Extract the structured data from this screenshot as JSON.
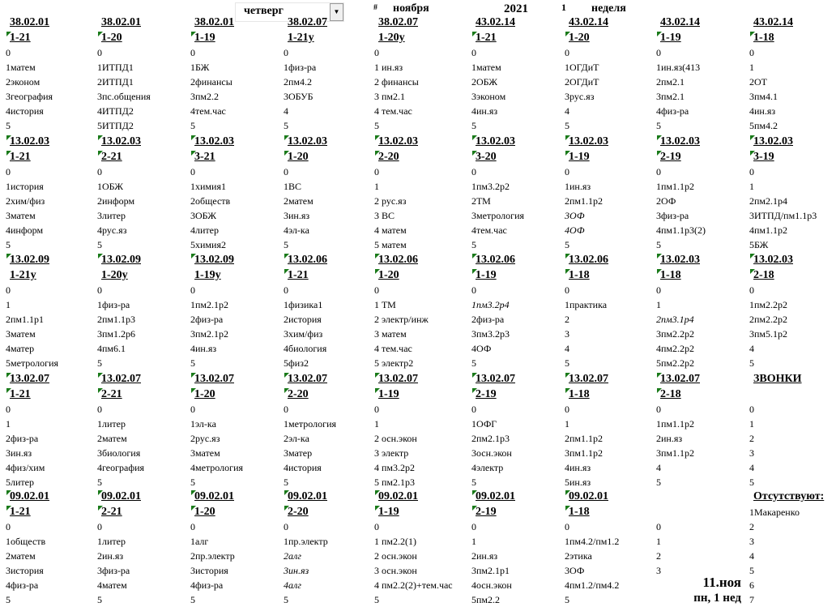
{
  "header": {
    "day_select": "четверг",
    "hash": "#",
    "month": "ноября",
    "year": "2021",
    "week_num": "1",
    "week_label": "неделя"
  },
  "footer": {
    "date": "11.ноя",
    "week_info": "пн, 1 нед"
  },
  "colors": {
    "comment_marker": "#1a7a1a"
  },
  "blocks": [
    [
      {
        "code": "38.02.01",
        "group": "1-21",
        "gm": true,
        "lessons": [
          "0",
          "1матем",
          "2эконом",
          "3география",
          "4история",
          "5"
        ]
      },
      {
        "code": "38.02.01",
        "group": "1-20",
        "gm": true,
        "lessons": [
          "0",
          "1ИТПД1",
          "2ИТПД1",
          "3пс.общения",
          "4ИТПД2",
          "5ИТПД2"
        ]
      },
      {
        "code": "38.02.01",
        "group": "1-19",
        "gm": true,
        "lessons": [
          "0",
          "1БЖ",
          "2финансы",
          "3пм2.2",
          "4тем.час",
          "5"
        ]
      },
      {
        "code": "38.02.07",
        "group": "1-21у",
        "lessons": [
          "0",
          "1физ-ра",
          "2пм4.2",
          "3ОБУБ",
          "4",
          "5"
        ]
      },
      {
        "code": "38.02.07",
        "group": "1-20у",
        "lessons": [
          "0",
          "1 ин.яз",
          "2 финансы",
          "3 пм2.1",
          "4 тем.час",
          "5"
        ]
      },
      {
        "code": "43.02.14",
        "group": "1-21",
        "gm": true,
        "lessons": [
          "0",
          "1матем",
          "2ОБЖ",
          "3эконом",
          "4ин.яз",
          "5"
        ]
      },
      {
        "code": "43.02.14",
        "group": "1-20",
        "gm": true,
        "lessons": [
          "0",
          "1ОГДиТ",
          "2ОГДиТ",
          "3рус.яз",
          "4",
          "5"
        ]
      },
      {
        "code": "43.02.14",
        "group": "1-19",
        "gm": true,
        "lessons": [
          "0",
          "1ин.яз(413",
          "2пм2.1",
          "3пм2.1",
          "4физ-ра",
          "5"
        ]
      },
      {
        "code": "43.02.14",
        "group": "1-18",
        "gm": true,
        "lessons": [
          "0",
          "1",
          "2ОТ",
          "3пм4.1",
          "4ин.яз",
          "5пм4.2"
        ]
      }
    ],
    [
      {
        "code": "13.02.03",
        "group": "1-21",
        "cm": true,
        "gm": true,
        "lessons": [
          "0",
          "1история",
          "2хим/физ",
          "3матем",
          "4информ",
          "5"
        ]
      },
      {
        "code": "13.02.03",
        "group": "2-21",
        "cm": true,
        "gm": true,
        "lessons": [
          "0",
          "1ОБЖ",
          "2информ",
          "3литер",
          "4рус.яз",
          "5"
        ]
      },
      {
        "code": "13.02.03",
        "group": "3-21",
        "cm": true,
        "gm": true,
        "lessons": [
          "0",
          "1химия1",
          "2обществ",
          "3ОБЖ",
          "4литер",
          "5химия2"
        ]
      },
      {
        "code": "13.02.03",
        "group": "1-20",
        "cm": true,
        "gm": true,
        "lessons": [
          "0",
          "1ВС",
          "2матем",
          "3ин.яз",
          "4эл-ка",
          "5"
        ]
      },
      {
        "code": "13.02.03",
        "group": "2-20",
        "cm": true,
        "gm": true,
        "lessons": [
          "0",
          "1",
          "2 рус.яз",
          "3 ВС",
          "4 матем",
          "5 матем"
        ]
      },
      {
        "code": "13.02.03",
        "group": "3-20",
        "cm": true,
        "gm": true,
        "lessons": [
          "0",
          "1пм3.2р2",
          "2ТМ",
          "3метрология",
          "4тем.час",
          "5"
        ]
      },
      {
        "code": "13.02.03",
        "group": "1-19",
        "cm": true,
        "gm": true,
        "italic": [
          3,
          4
        ],
        "lessons": [
          "0",
          "1ин.яз",
          "2пм1.1р2",
          "3ОФ",
          "4ОФ",
          "5"
        ]
      },
      {
        "code": "13.02.03",
        "group": "2-19",
        "cm": true,
        "gm": true,
        "lessons": [
          "0",
          "1пм1.1р2",
          "2ОФ",
          "3физ-ра",
          "4пм1.1р3(2)",
          "5"
        ]
      },
      {
        "code": "13.02.03",
        "group": "3-19",
        "cm": true,
        "gm": true,
        "lessons": [
          "0",
          "1",
          "2пм2.1р4",
          "3ИТПД/пм1.1р3",
          "4пм1.1р2",
          "5БЖ"
        ]
      }
    ],
    [
      {
        "code": "13.02.09",
        "group": "1-21у",
        "cm": true,
        "lessons": [
          "0",
          "1",
          "2пм1.1р1",
          "3матем",
          "4матер",
          "5метрология"
        ]
      },
      {
        "code": "13.02.09",
        "group": "1-20у",
        "cm": true,
        "lessons": [
          "0",
          "1физ-ра",
          "2пм1.1р3",
          "3пм1.2р6",
          "4пм6.1",
          "5"
        ]
      },
      {
        "code": "13.02.09",
        "group": "1-19у",
        "cm": true,
        "lessons": [
          "0",
          "1пм2.1р2",
          "2физ-ра",
          "3пм2.1р2",
          "4ин.яз",
          "5"
        ]
      },
      {
        "code": "13.02.06",
        "group": "1-21",
        "cm": true,
        "gm": true,
        "lessons": [
          "0",
          "1физика1",
          "2история",
          "3хим/физ",
          "4биология",
          "5физ2"
        ]
      },
      {
        "code": "13.02.06",
        "group": "1-20",
        "cm": true,
        "gm": true,
        "lessons": [
          "0",
          "1 ТМ",
          "2 электр/инж",
          "3 матем",
          "4 тем.час",
          "5 электр2"
        ]
      },
      {
        "code": "13.02.06",
        "group": "1-19",
        "cm": true,
        "gm": true,
        "italic": [
          1
        ],
        "lessons": [
          "0",
          "1пм3.2р4",
          "2физ-ра",
          "3пм3.2р3",
          "4ОФ",
          "5"
        ]
      },
      {
        "code": "13.02.06",
        "group": "1-18",
        "cm": true,
        "gm": true,
        "lessons": [
          "0",
          "1практика",
          "2",
          "3",
          "4",
          "5"
        ]
      },
      {
        "code": "13.02.03",
        "group": "1-18",
        "cm": true,
        "gm": true,
        "italic": [
          2
        ],
        "lessons": [
          "0",
          "1",
          "2пм3.1р4",
          "3пм2.2р2",
          "4пм2.2р2",
          "5пм2.2р2"
        ]
      },
      {
        "code": "13.02.03",
        "group": "2-18",
        "cm": true,
        "gm": true,
        "lessons": [
          "0",
          "1пм2.2р2",
          "2пм2.2р2",
          "3пм5.1р2",
          "4",
          "5"
        ]
      }
    ],
    [
      {
        "code": "13.02.07",
        "group": "1-21",
        "cm": true,
        "gm": true,
        "lessons": [
          "0",
          "1",
          "2физ-ра",
          "3ин.яз",
          "4физ/хим",
          "5литер"
        ]
      },
      {
        "code": "13.02.07",
        "group": "2-21",
        "cm": true,
        "gm": true,
        "lessons": [
          "0",
          "1литер",
          "2матем",
          "3биология",
          "4география",
          "5"
        ]
      },
      {
        "code": "13.02.07",
        "group": "1-20",
        "cm": true,
        "gm": true,
        "lessons": [
          "0",
          "1эл-ка",
          "2рус.яз",
          "3матем",
          "4метрология",
          "5"
        ]
      },
      {
        "code": "13.02.07",
        "group": "2-20",
        "cm": true,
        "gm": true,
        "lessons": [
          "0",
          "1метрология",
          "2эл-ка",
          "3матер",
          "4история",
          "5"
        ]
      },
      {
        "code": "13.02.07",
        "group": "1-19",
        "cm": true,
        "gm": true,
        "lessons": [
          "0",
          "1",
          "2 осн.экон",
          "3 электр",
          "4 пм3.2р2",
          "5 пм2.1р3"
        ]
      },
      {
        "code": "13.02.07",
        "group": "2-19",
        "cm": true,
        "gm": true,
        "lessons": [
          "0",
          "1ОФГ",
          "2пм2.1р3",
          "3осн.экон",
          "4электр",
          "5"
        ]
      },
      {
        "code": "13.02.07",
        "group": "1-18",
        "cm": true,
        "gm": true,
        "lessons": [
          "0",
          "1",
          "2пм1.1р2",
          "3пм1.1р2",
          "4ин.яз",
          "5ин.яз"
        ]
      },
      {
        "code": "13.02.07",
        "group": "2-18",
        "cm": true,
        "gm": true,
        "lessons": [
          "0",
          "1пм1.1р2",
          "2ин.яз",
          "3пм1.1р2",
          "4",
          "5"
        ]
      },
      {
        "code": "ЗВОНКИ",
        "group": "",
        "lessons": [
          "0",
          "1",
          "2",
          "3",
          "4",
          "5"
        ]
      }
    ],
    [
      {
        "code": "09.02.01",
        "group": "1-21",
        "cm": true,
        "gm": true,
        "lessons": [
          "0",
          "1обществ",
          "2матем",
          "3история",
          "4физ-ра",
          "5"
        ]
      },
      {
        "code": "09.02.01",
        "group": "2-21",
        "cm": true,
        "gm": true,
        "lessons": [
          "0",
          "1литер",
          "2ин.яз",
          "3физ-ра",
          "4матем",
          "5"
        ]
      },
      {
        "code": "09.02.01",
        "group": "1-20",
        "cm": true,
        "gm": true,
        "lessons": [
          "0",
          "1алг",
          "2пр.электр",
          "3история",
          "4физ-ра",
          "5"
        ]
      },
      {
        "code": "09.02.01",
        "group": "2-20",
        "cm": true,
        "gm": true,
        "italic": [
          2,
          3,
          4
        ],
        "lessons": [
          "0",
          "1пр.электр",
          "2алг",
          "3ин.яз",
          "4алг",
          "5"
        ]
      },
      {
        "code": "09.02.01",
        "group": "1-19",
        "cm": true,
        "gm": true,
        "lessons": [
          "0",
          "1 пм2.2(1)",
          "2 осн.экон",
          "3 осн.экон",
          "4 пм2.2(2)+тем.час",
          "5"
        ]
      },
      {
        "code": "09.02.01",
        "group": "2-19",
        "cm": true,
        "gm": true,
        "lessons": [
          "0",
          "1",
          "2ин.яз",
          "3пм2.1р1",
          "4осн.экон",
          "5пм2.2"
        ]
      },
      {
        "code": "09.02.01",
        "group": "1-18",
        "cm": true,
        "gm": true,
        "lessons": [
          "0",
          "1пм4.2/пм1.2",
          "2этика",
          "3ОФ",
          "4пм1.2/пм4.2",
          "5"
        ]
      },
      {
        "code": "",
        "group": "",
        "lessons": [
          "0",
          "1",
          "2",
          "3"
        ]
      },
      {
        "code": "Отсутствуют:",
        "group": "",
        "absent": true,
        "lessons": [
          "1Макаренко",
          "2",
          "3",
          "4",
          "5",
          "6",
          "7"
        ]
      }
    ]
  ]
}
